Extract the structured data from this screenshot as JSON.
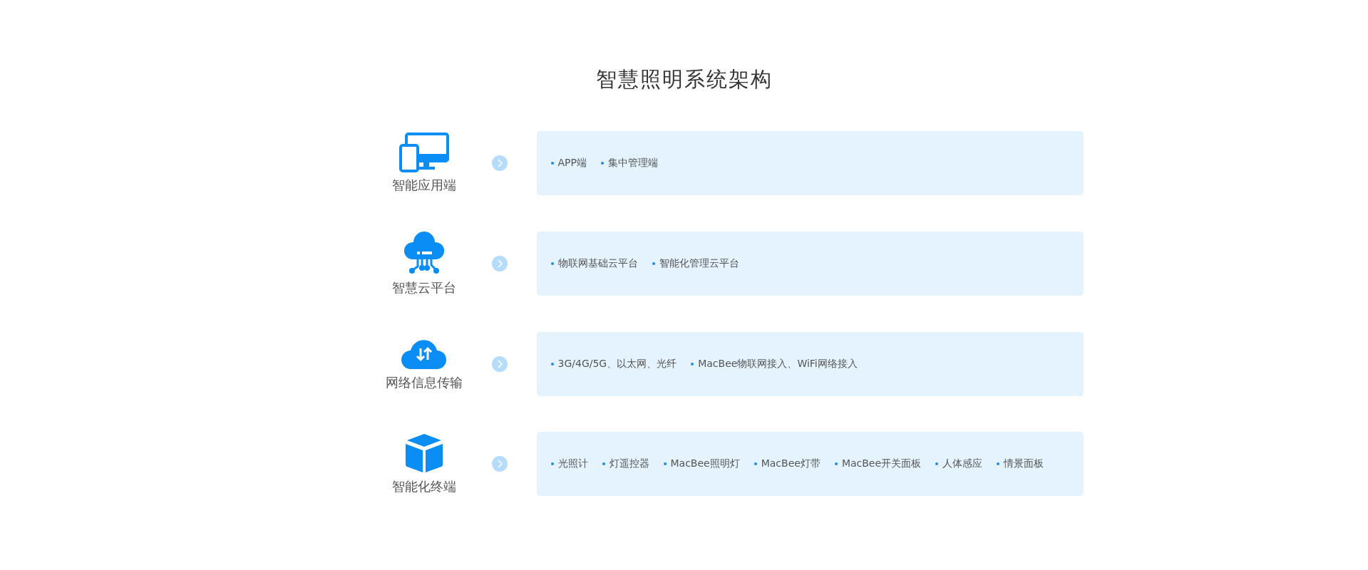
{
  "title": "智慧照明系统架构",
  "layers": [
    {
      "kind": "devices",
      "label": "智能应用端",
      "items": [
        "APP端",
        "集中管理端"
      ]
    },
    {
      "kind": "cloud",
      "label": "智慧云平台",
      "items": [
        "物联网基础云平台",
        "智能化管理云平台"
      ]
    },
    {
      "kind": "transfer",
      "label": "网络信息传输",
      "items": [
        "3G/4G/5G、以太网、光纤",
        "MacBee物联网接入、WiFi网络接入"
      ]
    },
    {
      "kind": "box",
      "label": "智能化终端",
      "items": [
        "光照计",
        "灯遥控器",
        "MacBee照明灯",
        "MacBee灯带",
        "MacBee开关面板",
        "人体感应",
        "情景面板"
      ]
    }
  ]
}
